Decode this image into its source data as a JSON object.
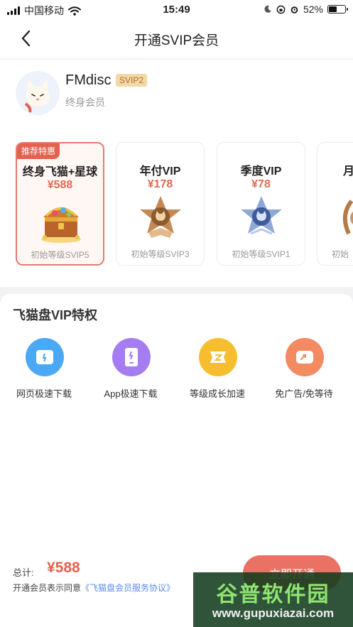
{
  "status_bar": {
    "carrier": "中国移动",
    "time": "15:49",
    "battery": "52%",
    "battery_level": 0.52
  },
  "nav": {
    "title": "开通SVIP会员",
    "back_icon": "chevron-left-icon"
  },
  "user": {
    "name": "FMdisc",
    "vip_level": "SVIP2",
    "member_type": "终身会员"
  },
  "plans": [
    {
      "tag": "推荐特惠",
      "name": "终身飞猫+星球",
      "price": "¥588",
      "level": "初始等级SVIP5",
      "selected": true,
      "icon": "treasure-chest-icon"
    },
    {
      "name": "年付VIP",
      "price": "¥178",
      "level": "初始等级SVIP3",
      "icon": "bronze-star-badge-icon"
    },
    {
      "name": "季度VIP",
      "price": "¥78",
      "level": "初始等级SVIP1",
      "icon": "silver-star-badge-icon"
    },
    {
      "name": "月",
      "price": "",
      "level": "初始",
      "icon": "laurel-badge-icon"
    }
  ],
  "privileges": {
    "title": "飞猫盘VIP特权",
    "items": [
      {
        "label": "网页极速下载",
        "icon": "web-download-icon",
        "color": "#4aa8f5"
      },
      {
        "label": "App极速下载",
        "icon": "app-download-icon",
        "color": "#a57cf2"
      },
      {
        "label": "等级成长加速",
        "icon": "level-up-icon",
        "color": "#f6be2e"
      },
      {
        "label": "免广告/免等待",
        "icon": "no-ads-icon",
        "color": "#f28a62"
      }
    ]
  },
  "footer": {
    "total_label": "总计:",
    "total_price": "¥588",
    "agreement_prefix": "开通会员表示同意",
    "agreement_link": "《飞猫盘会员服务协议》",
    "open_button": "立即开通"
  },
  "watermark": {
    "line1": "谷普软件园",
    "line2": "www.gupuxiazai.com"
  },
  "colors": {
    "accent": "#e3624f",
    "link": "#5b8def"
  }
}
